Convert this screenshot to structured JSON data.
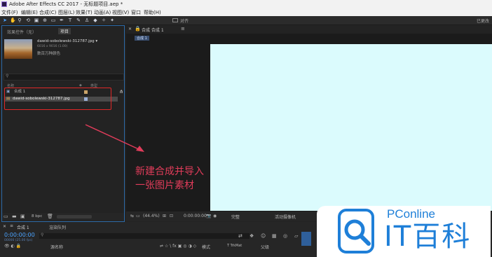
{
  "window": {
    "title": "Adobe After Effects CC 2017 - 无标题项目.aep *"
  },
  "menu": [
    "文件(F)",
    "编辑(E)",
    "合成(C)",
    "图层(L)",
    "效果(T)",
    "动画(A)",
    "视图(V)",
    "窗口",
    "帮助(H)"
  ],
  "toolbar": {
    "snap_label": "对齐",
    "workspace": "已更改"
  },
  "project_panel": {
    "tabs": [
      "效果控件（无）",
      "项目"
    ],
    "asset_name": "dawid-sobolewski-312787.jpg ▾",
    "asset_info": "6016 x 9016 (1.00)",
    "asset_note": "数百万种颜色",
    "col_name": "名称",
    "col_type": "类型",
    "items": [
      "合成 1",
      "dawid-sobolewski-312787.jpg"
    ],
    "footer_bpc": "8 bpc"
  },
  "composition": {
    "tab_label": "合成 合成 1",
    "sub_tab": "合成 1",
    "zoom": "(44.4%)",
    "timecode": "0:00:00:00",
    "quality": "完整",
    "camera": "活动摄像机"
  },
  "timeline": {
    "tab_label": "合成 1",
    "render_queue": "渲染队列",
    "timecode": "0:00:00:00",
    "fps": "00000 (25.00 fps)",
    "col_source": "源名称",
    "col_mode": "模式",
    "col_trkmat": "T TrkMat",
    "col_parent": "父级"
  },
  "annotation": {
    "line1": "新建合成并导入",
    "line2": "一张图片素材",
    "color": "#e03c5a"
  },
  "watermark": {
    "brand": "PConline",
    "text": "IT百科",
    "color": "#1e7fd8"
  }
}
